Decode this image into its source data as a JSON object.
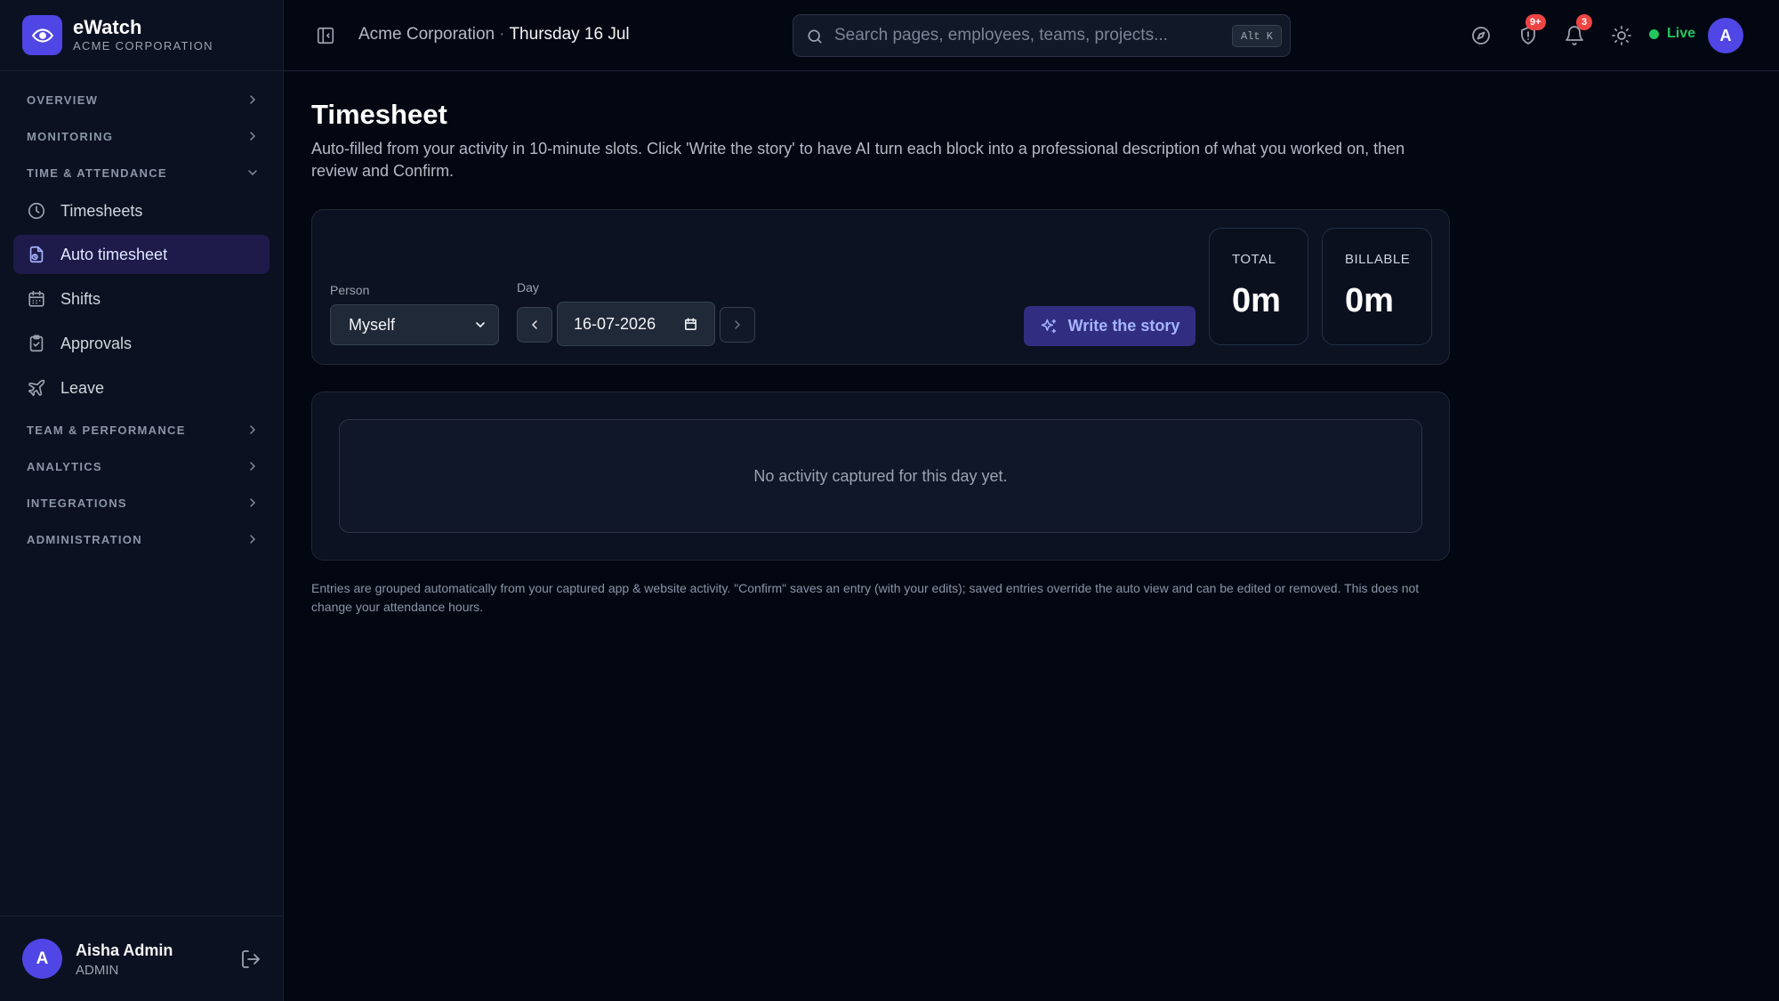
{
  "brand": {
    "name": "eWatch",
    "subtitle": "ACME CORPORATION"
  },
  "sidebar": {
    "sections": [
      {
        "label": "OVERVIEW",
        "expanded": false
      },
      {
        "label": "MONITORING",
        "expanded": false
      },
      {
        "label": "TIME & ATTENDANCE",
        "expanded": true
      },
      {
        "label": "TEAM & PERFORMANCE",
        "expanded": false
      },
      {
        "label": "ANALYTICS",
        "expanded": false
      },
      {
        "label": "INTEGRATIONS",
        "expanded": false
      },
      {
        "label": "ADMINISTRATION",
        "expanded": false
      }
    ],
    "items": [
      {
        "label": "Timesheets",
        "icon": "clock-icon"
      },
      {
        "label": "Auto timesheet",
        "icon": "auto-timer-icon",
        "active": true
      },
      {
        "label": "Shifts",
        "icon": "calendar-icon"
      },
      {
        "label": "Approvals",
        "icon": "clipboard-check-icon"
      },
      {
        "label": "Leave",
        "icon": "plane-icon"
      }
    ]
  },
  "user": {
    "initial": "A",
    "name": "Aisha Admin",
    "role": "ADMIN"
  },
  "header": {
    "org": "Acme Corporation",
    "separator": "·",
    "date": "Thursday 16 Jul",
    "search_placeholder": "Search pages, employees, teams, projects...",
    "search_shortcut": "Alt K",
    "alerts_badge": "9+",
    "notifications_badge": "3",
    "live_label": "Live",
    "avatar_initial": "A"
  },
  "page": {
    "title": "Timesheet",
    "description": "Auto-filled from your activity in 10-minute slots. Click 'Write the story' to have AI turn each block into a professional description of what you worked on, then review and Confirm.",
    "person_label": "Person",
    "person_value": "Myself",
    "day_label": "Day",
    "day_value": "16-07-2026",
    "story_button": "Write the story",
    "total_label": "TOTAL",
    "total_value": "0m",
    "billable_label": "BILLABLE",
    "billable_value": "0m",
    "empty_message": "No activity captured for this day yet.",
    "footnote": "Entries are grouped automatically from your captured app & website activity. \"Confirm\" saves an entry (with your edits); saved entries override the auto view and can be edited or removed. This does not change your attendance hours."
  },
  "colors": {
    "accent": "#4f46e5",
    "background": "#030712",
    "live": "#22c55e",
    "badge": "#ef4444"
  }
}
